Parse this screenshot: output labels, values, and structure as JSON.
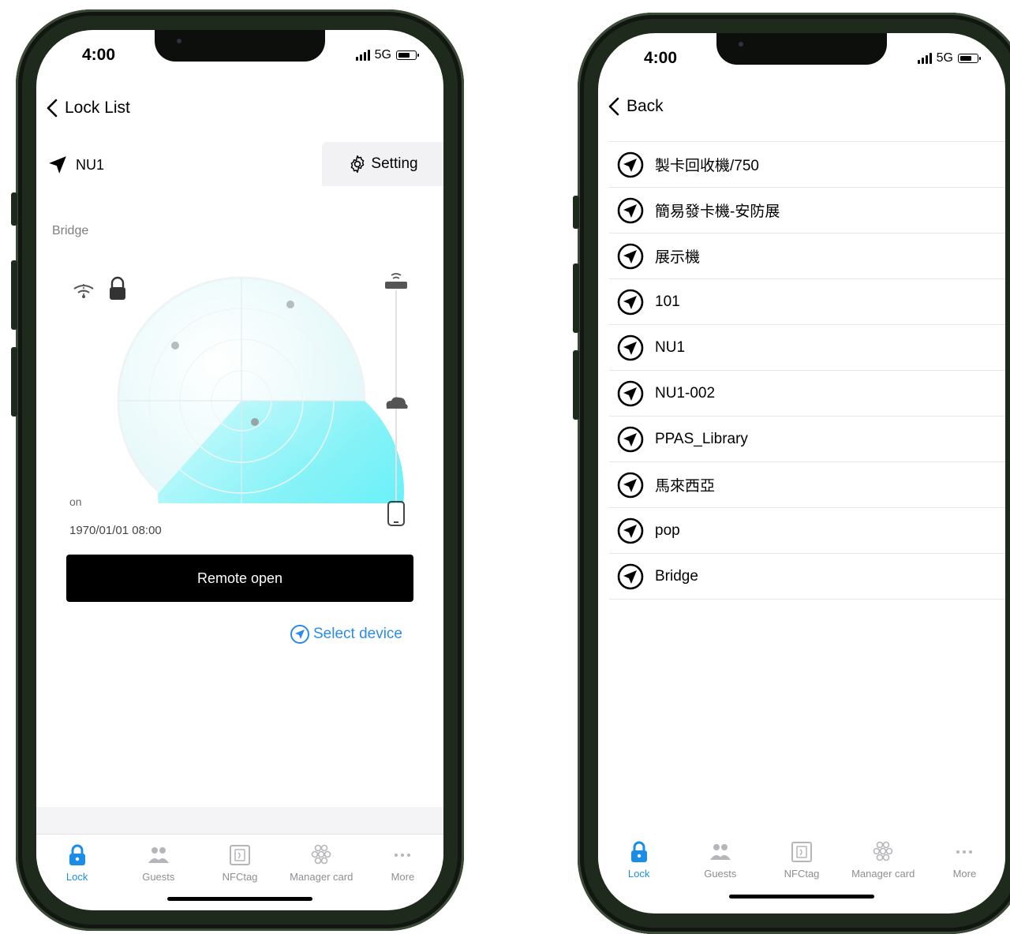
{
  "status_bar": {
    "time": "4:00",
    "network": "5G"
  },
  "left": {
    "nav_back_label": "Lock List",
    "lock_name": "NU1",
    "setting_label": "Setting",
    "bridge_label": "Bridge",
    "on_label": "on",
    "date": "1970/01/01 08:00",
    "remote_open_label": "Remote open",
    "select_device_label": "Select device"
  },
  "right": {
    "nav_back_label": "Back",
    "devices": [
      "製卡回收機/750",
      "簡易發卡機-安防展",
      "展示機",
      "101",
      "NU1",
      "NU1-002",
      "PPAS_Library",
      "馬來西亞",
      "pop",
      "Bridge"
    ]
  },
  "tabs": [
    {
      "label": "Lock",
      "icon": "lock-icon"
    },
    {
      "label": "Guests",
      "icon": "guests-icon"
    },
    {
      "label": "NFCtag",
      "icon": "nfc-tag-icon"
    },
    {
      "label": "Manager card",
      "icon": "manager-card-icon"
    },
    {
      "label": "More",
      "icon": "more-icon"
    }
  ],
  "colors": {
    "accent": "#1a8ee6",
    "link": "#2b8be6",
    "radar": "#4ef0f7",
    "button": "#000000"
  }
}
